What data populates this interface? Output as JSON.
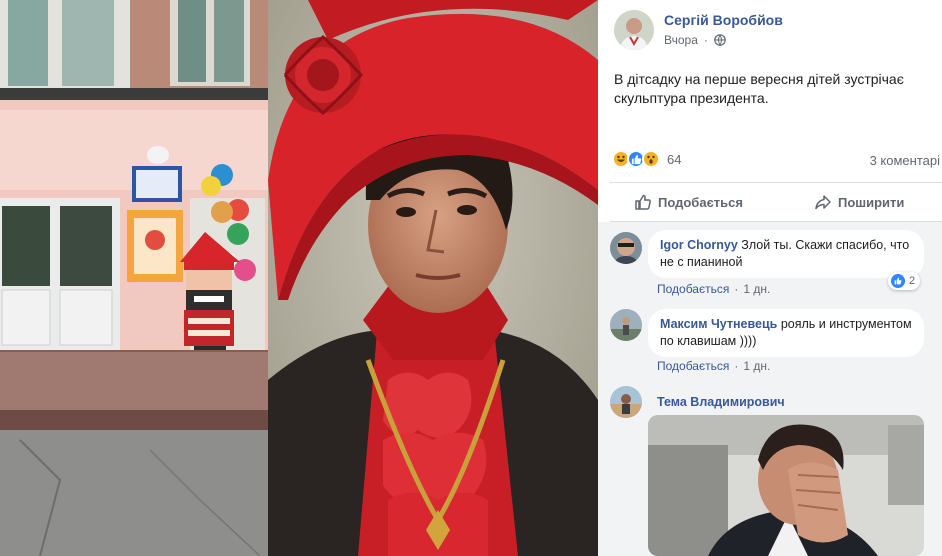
{
  "post": {
    "author": "Сергій Воробйов",
    "time": "Вчора",
    "privacy_icon": "globe-icon",
    "text": "В дітсадку на перше вересня дітей зустрічає скульптура президента."
  },
  "stats": {
    "reaction_icons": [
      "haha-reaction-icon",
      "like-reaction-icon",
      "wow-reaction-icon"
    ],
    "reaction_count": "64",
    "comment_count": "3 коментарі"
  },
  "actions": {
    "like_label": "Подобається",
    "share_label": "Поширити"
  },
  "comments": [
    {
      "author": "Igor Chornyy",
      "text": "Злой ты. Скажи спасибо, что не с пианиной",
      "like_label": "Подобається",
      "time": "1 дн.",
      "likes": "2"
    },
    {
      "author": "Максим Чутневець",
      "text": "рояль и инструментом по клавишам ))))",
      "like_label": "Подобається",
      "time": "1 дн."
    },
    {
      "author": "Тема Владимирович"
    }
  ],
  "colors": {
    "link_blue": "#385898",
    "hat_red": "#d8232a",
    "wall_pink": "#f1c9c0",
    "like_blue": "#2d88ff"
  }
}
